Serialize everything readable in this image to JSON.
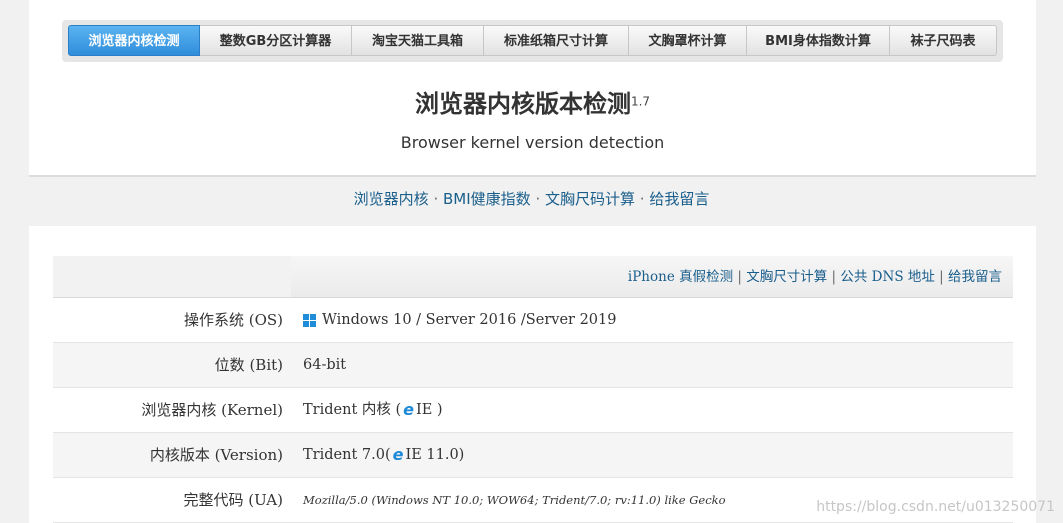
{
  "tabs": [
    {
      "label": "浏览器内核检测",
      "active": true
    },
    {
      "label": "整数GB分区计算器"
    },
    {
      "label": "淘宝天猫工具箱"
    },
    {
      "label": "标准纸箱尺寸计算"
    },
    {
      "label": "文胸罩杯计算"
    },
    {
      "label": "BMI身体指数计算"
    },
    {
      "label": "袜子尺码表"
    }
  ],
  "title": "浏览器内核版本检测",
  "version": "1.7",
  "subtitle": "Browser kernel version detection",
  "quick_links": [
    "浏览器内核",
    "BMI健康指数",
    "文胸尺码计算",
    "给我留言"
  ],
  "table_links": [
    "iPhone 真假检测",
    "文胸尺寸计算",
    "公共 DNS 地址",
    "给我留言"
  ],
  "rows": [
    {
      "label": "操作系统 (OS)",
      "value": "Windows 10 / Server 2016 /Server 2019",
      "icon": "windows-icon"
    },
    {
      "label": "位数 (Bit)",
      "value": "64-bit"
    },
    {
      "label": "浏览器内核 (Kernel)",
      "value_prefix": "Trident 内核 (",
      "icon": "ie-icon",
      "value_suffix": " IE )"
    },
    {
      "label": "内核版本 (Version)",
      "value_prefix": "Trident 7.0(",
      "icon": "ie-icon",
      "value_suffix": " IE 11.0)"
    },
    {
      "label": "完整代码 (UA)",
      "value": "Mozilla/5.0 (Windows NT 10.0; WOW64; Trident/7.0; rv:11.0) like Gecko"
    }
  ],
  "watermark": "https://blog.csdn.net/u013250071",
  "colors": {
    "accent": "#2f8ddb",
    "link": "#1a5e8c",
    "icon_blue": "#1e8cd8"
  }
}
